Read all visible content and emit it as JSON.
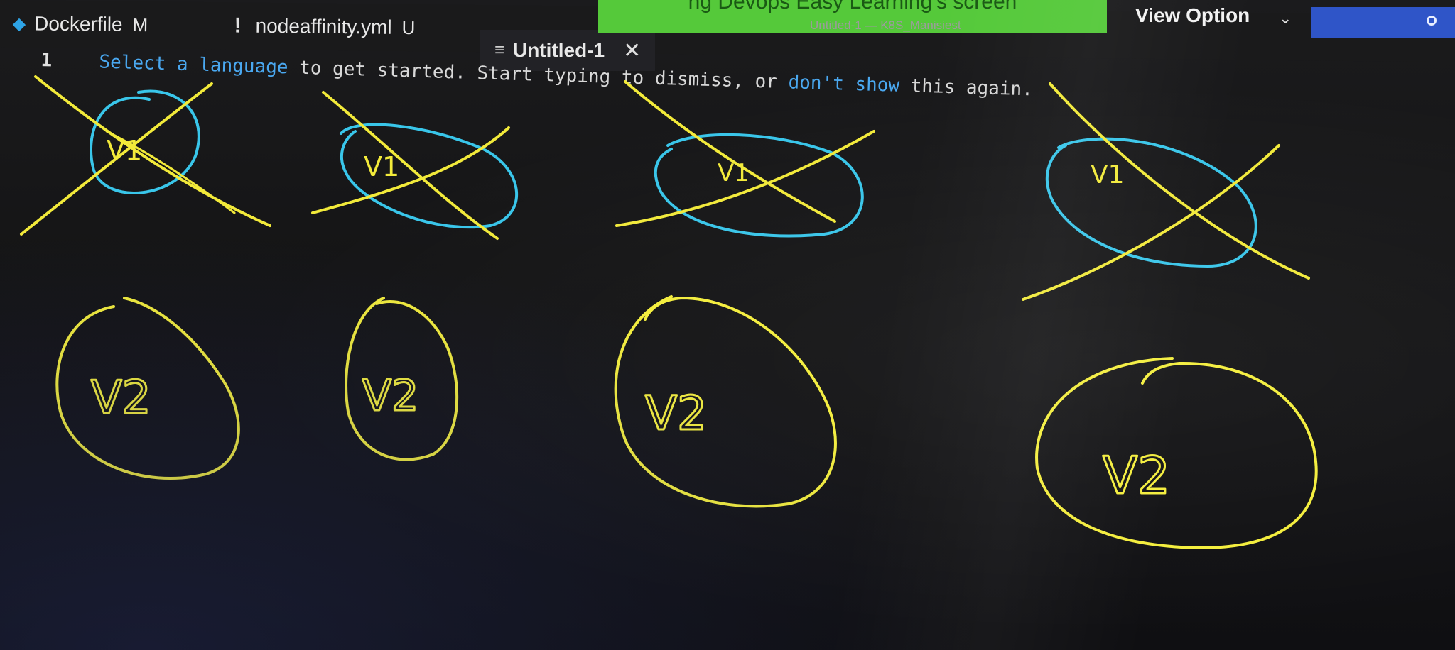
{
  "tabs": [
    {
      "label": "Dockerfile",
      "mark": "M",
      "icon": "docker-icon"
    },
    {
      "label": "nodeaffinity.yml",
      "mark": "U",
      "icon": "exclamation-icon"
    },
    {
      "label": "Untitled-1",
      "icon": "file-lines-icon",
      "close_icon": "close-icon"
    }
  ],
  "banner": {
    "text": "ng Devops Easy Learning's screen"
  },
  "window_title": "Untitled-1 — K8S_Manisiest",
  "view_option": {
    "label": "View Option"
  },
  "editor": {
    "line_number": "1",
    "hint": {
      "link1": "Select a language",
      "text1": " to get started. Start typing to dismiss, or ",
      "link2": "don't show",
      "text2": " this again."
    }
  },
  "annotations": {
    "crossed_labels": [
      "V1",
      "V1",
      "V1",
      "V1"
    ],
    "circled_labels": [
      "V2",
      "V2",
      "V2",
      "V2"
    ],
    "colors": {
      "crossed_circle": "#39c6ea",
      "cross_lines": "#f2ea3a",
      "circles": "#f4ee3c"
    }
  }
}
